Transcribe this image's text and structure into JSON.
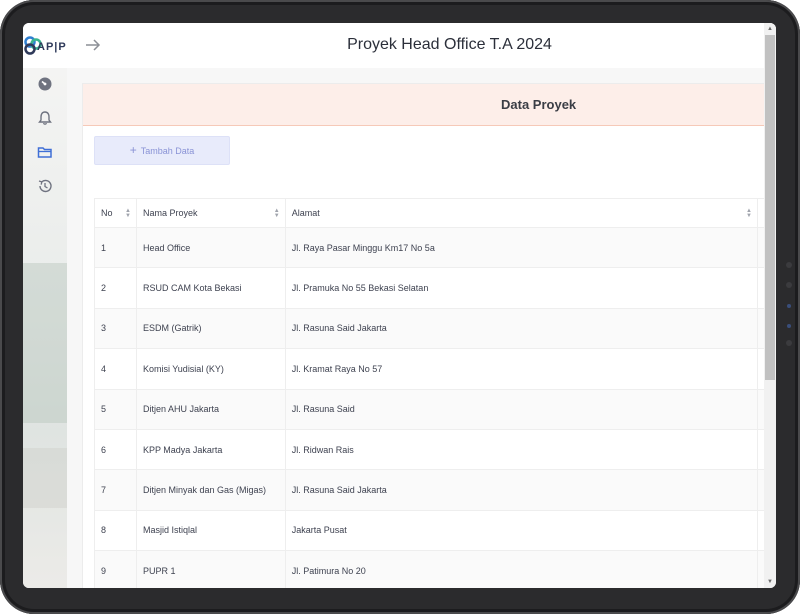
{
  "header": {
    "logo_text": "AP|P",
    "title": "Proyek Head Office T.A 2024",
    "arrow_icon": "arrow-right-icon"
  },
  "sidebar": {
    "items": [
      {
        "icon": "dashboard-gauge-icon"
      },
      {
        "icon": "bell-icon"
      },
      {
        "icon": "folder-icon"
      },
      {
        "icon": "history-icon"
      }
    ]
  },
  "card": {
    "title": "Data Proyek",
    "add_button_label": "Tambah Data",
    "add_button_icon": "plus-icon"
  },
  "table": {
    "columns": [
      "No",
      "Nama Proyek",
      "Alamat"
    ],
    "rows": [
      {
        "no": "1",
        "name": "Head Office",
        "address": "Jl. Raya Pasar Minggu Km17 No 5a"
      },
      {
        "no": "2",
        "name": "RSUD CAM Kota Bekasi",
        "address": "Jl. Pramuka No 55 Bekasi Selatan"
      },
      {
        "no": "3",
        "name": "ESDM (Gatrik)",
        "address": "Jl. Rasuna Said Jakarta"
      },
      {
        "no": "4",
        "name": "Komisi Yudisial (KY)",
        "address": "Jl. Kramat Raya No 57"
      },
      {
        "no": "5",
        "name": "Ditjen AHU Jakarta",
        "address": "Jl. Rasuna Said"
      },
      {
        "no": "6",
        "name": "KPP Madya Jakarta",
        "address": "Jl. Ridwan Rais"
      },
      {
        "no": "7",
        "name": "Ditjen Minyak dan Gas (Migas)",
        "address": "Jl. Rasuna Said Jakarta"
      },
      {
        "no": "8",
        "name": "Masjid Istiqlal",
        "address": "Jakarta Pusat"
      },
      {
        "no": "9",
        "name": "PUPR 1",
        "address": "Jl. Patimura No 20"
      }
    ]
  },
  "colors": {
    "accent_header_bg": "#fdeee9",
    "add_button_bg": "#e8ebfb",
    "add_button_text": "#8a93d6"
  }
}
